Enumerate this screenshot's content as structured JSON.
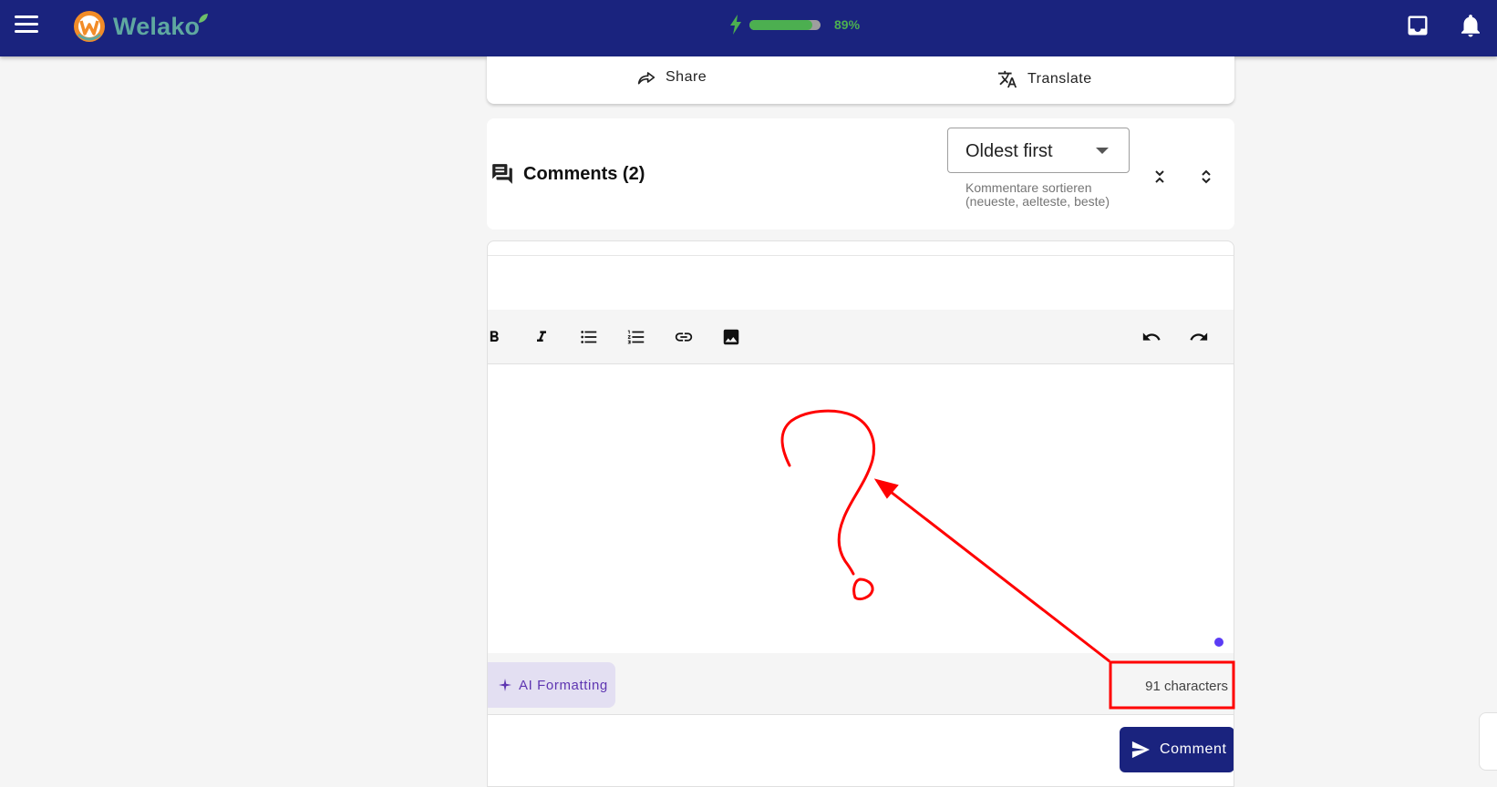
{
  "header": {
    "app_name": "Welako",
    "battery_percent": 89,
    "battery_label": "89%"
  },
  "actions": {
    "share_label": "Share",
    "translate_label": "Translate"
  },
  "comments": {
    "title": "Comments (2)",
    "sort_selected": "Oldest first",
    "sort_helper": "Kommentare sortieren (neueste, aelteste, beste)"
  },
  "editor": {
    "ai_label": "AI Formatting",
    "char_count": "91 characters",
    "submit_label": "Comment"
  },
  "colors": {
    "appbar": "#1a237e",
    "battery": "#4caf50",
    "accent_purple": "#5e35b1",
    "annotation_red": "#ff0000"
  }
}
